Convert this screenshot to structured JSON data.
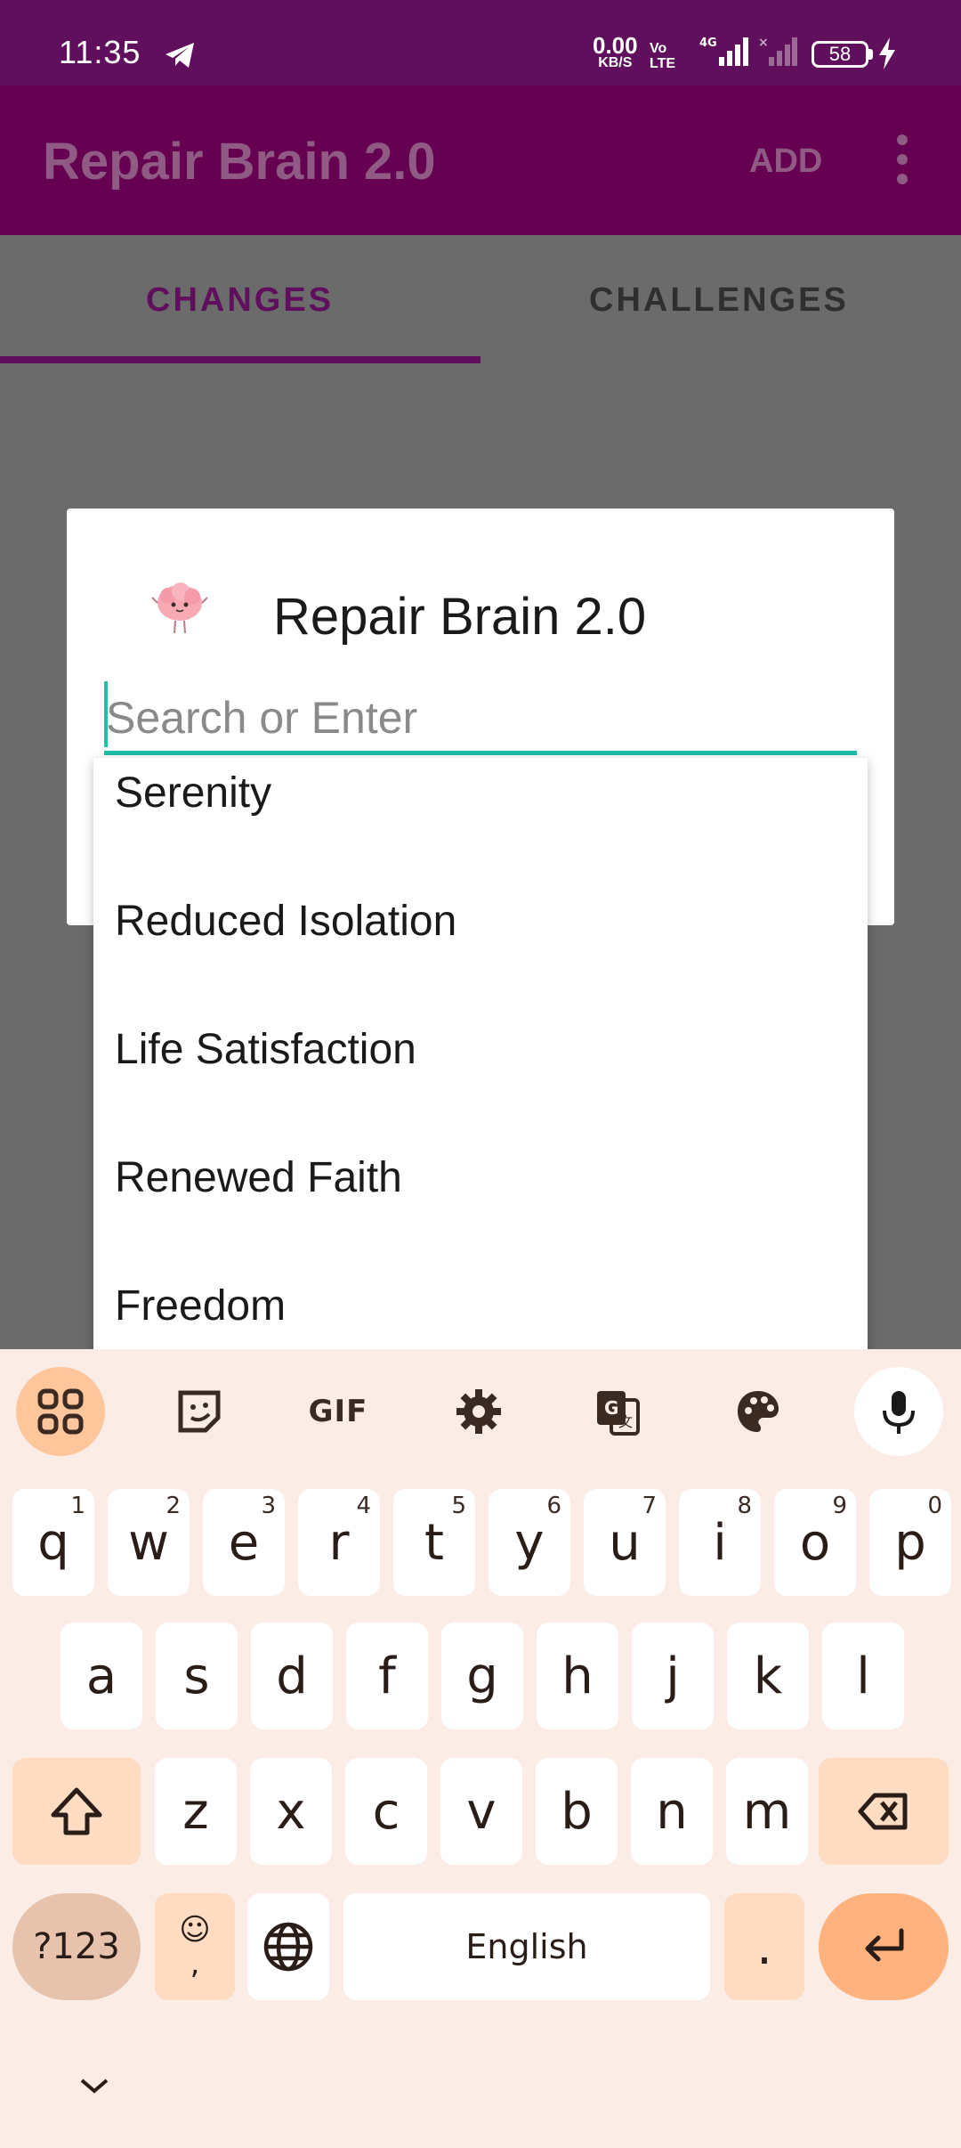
{
  "status_bar": {
    "time": "11:35",
    "net_speed": "0.00",
    "net_unit": "KB/S",
    "volte_top": "Vo",
    "volte_bottom": "LTE",
    "network": "4G",
    "battery": "58"
  },
  "app_bar": {
    "title": "Repair Brain 2.0",
    "add_label": "ADD"
  },
  "tabs": [
    {
      "label": "CHANGES",
      "selected": true
    },
    {
      "label": "CHALLENGES",
      "selected": false
    }
  ],
  "dialog": {
    "title": "Repair Brain 2.0",
    "search_placeholder": "Search or Enter",
    "search_value": ""
  },
  "dropdown": {
    "items": [
      "Serenity",
      "Reduced Isolation",
      "Life Satisfaction",
      "Renewed Faith",
      "Freedom"
    ]
  },
  "keyboard": {
    "toolbar": [
      "apps-icon",
      "sticker-icon",
      "GIF",
      "settings-icon",
      "translate-icon",
      "palette-icon",
      "mic-icon"
    ],
    "gif_label": "GIF",
    "row1": [
      {
        "k": "q",
        "n": "1"
      },
      {
        "k": "w",
        "n": "2"
      },
      {
        "k": "e",
        "n": "3"
      },
      {
        "k": "r",
        "n": "4"
      },
      {
        "k": "t",
        "n": "5"
      },
      {
        "k": "y",
        "n": "6"
      },
      {
        "k": "u",
        "n": "7"
      },
      {
        "k": "i",
        "n": "8"
      },
      {
        "k": "o",
        "n": "9"
      },
      {
        "k": "p",
        "n": "0"
      }
    ],
    "row2": [
      "a",
      "s",
      "d",
      "f",
      "g",
      "h",
      "j",
      "k",
      "l"
    ],
    "row3": [
      "z",
      "x",
      "c",
      "v",
      "b",
      "n",
      "m"
    ],
    "sym_label": "?123",
    "emoji_label": "☺",
    "comma_label": ",",
    "space_label": "English",
    "period_label": "."
  },
  "colors": {
    "status_bar": "#5f0f5c",
    "app_bar": "#660050",
    "accent": "#1fbfa8",
    "keyboard_bg": "#fbece6"
  }
}
